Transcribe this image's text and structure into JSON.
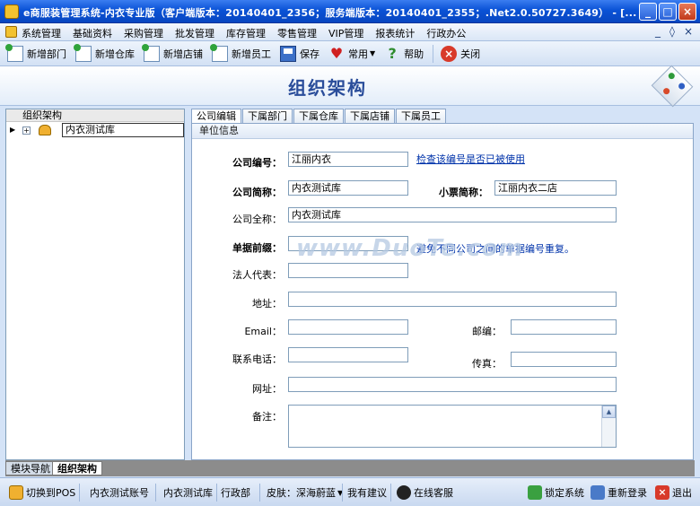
{
  "window": {
    "title": "e商服装管理系统-内衣专业版（客户端版本：20140401_2356；服务端版本：20140401_2355；.Net2.0.50727.3649） - [..."
  },
  "menu": {
    "items": [
      "系统管理",
      "基础资料",
      "采购管理",
      "批发管理",
      "库存管理",
      "零售管理",
      "VIP管理",
      "报表统计",
      "行政办公"
    ]
  },
  "toolbar": {
    "new_dept": "新增部门",
    "new_warehouse": "新增仓库",
    "new_store": "新增店铺",
    "new_employee": "新增员工",
    "save": "保存",
    "common": "常用",
    "help": "帮助",
    "close": "关闭"
  },
  "banner": {
    "title": "组织架构"
  },
  "tree": {
    "header": "组织架构",
    "root_label": "内衣测试库"
  },
  "tabs": [
    "公司编辑",
    "下属部门",
    "下属仓库",
    "下属店铺",
    "下属员工"
  ],
  "form": {
    "section": "单位信息",
    "company_code_label": "公司编号：",
    "company_code_value": "江丽内衣",
    "check_code_link": "检查该编号是否已被使用",
    "company_short_label": "公司简称：",
    "company_short_value": "内衣测试库",
    "receipt_short_label": "小票简称：",
    "receipt_short_value": "江丽内衣二店",
    "company_full_label": "公司全称：",
    "company_full_value": "内衣测试库",
    "doc_prefix_label": "单据前缀：",
    "doc_prefix_value": "",
    "doc_prefix_note": "避免不同公司之间的单据编号重复。",
    "legal_rep_label": "法人代表：",
    "legal_rep_value": "",
    "address_label": "地址：",
    "address_value": "",
    "email_label": "Email：",
    "email_value": "",
    "postcode_label": "邮编：",
    "postcode_value": "",
    "phone_label": "联系电话：",
    "phone_value": "",
    "fax_label": "传真：",
    "fax_value": "",
    "website_label": "网址：",
    "website_value": "",
    "remarks_label": "备注：",
    "remarks_value": ""
  },
  "watermark": "www.DuoTe.com",
  "module_tabs": [
    "模块导航",
    "组织架构"
  ],
  "status": {
    "switch_pos": "切换到POS",
    "account": "内衣测试账号",
    "db": "内衣测试库",
    "dept": "行政部",
    "skin": "皮肤：深海蔚蓝",
    "suggest": "我有建议",
    "service": "在线客服",
    "lock": "锁定系统",
    "relogin": "重新登录",
    "exit": "退出"
  },
  "colors": {
    "titlebar": "#0a52d6",
    "accent": "#2a4d9a",
    "link": "#0033aa"
  }
}
